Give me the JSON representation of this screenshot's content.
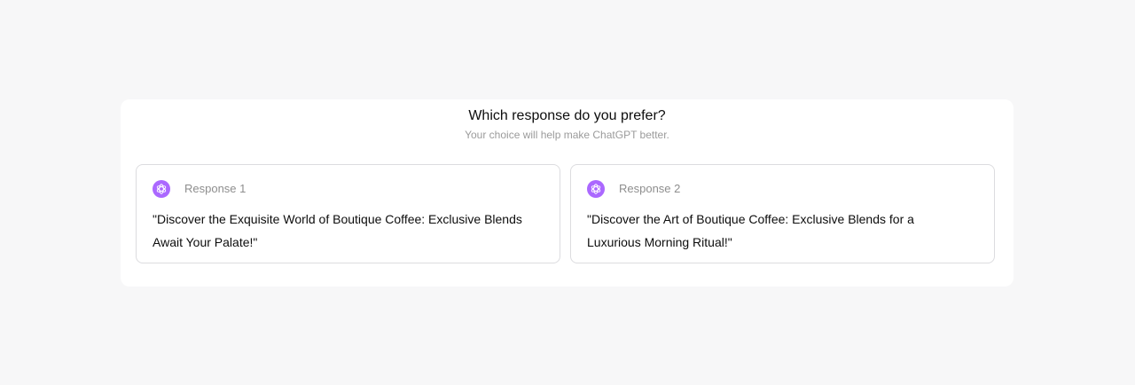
{
  "feedback": {
    "question": "Which response do you prefer?",
    "subtitle": "Your choice will help make ChatGPT better.",
    "responses": [
      {
        "label": "Response 1",
        "text": "\"Discover the Exquisite World of Boutique Coffee: Exclusive Blends Await Your Palate!\"",
        "icon": "openai-logo-icon"
      },
      {
        "label": "Response 2",
        "text": "\"Discover the Art of Boutique Coffee: Exclusive Blends for a Luxurious Morning Ritual!\"",
        "icon": "openai-logo-icon"
      }
    ]
  },
  "colors": {
    "background": "#f7f7f8",
    "panel": "#ffffff",
    "avatar": "#ab68ff",
    "card_border": "#dcdcdf",
    "muted_text": "#9b9b9b"
  }
}
